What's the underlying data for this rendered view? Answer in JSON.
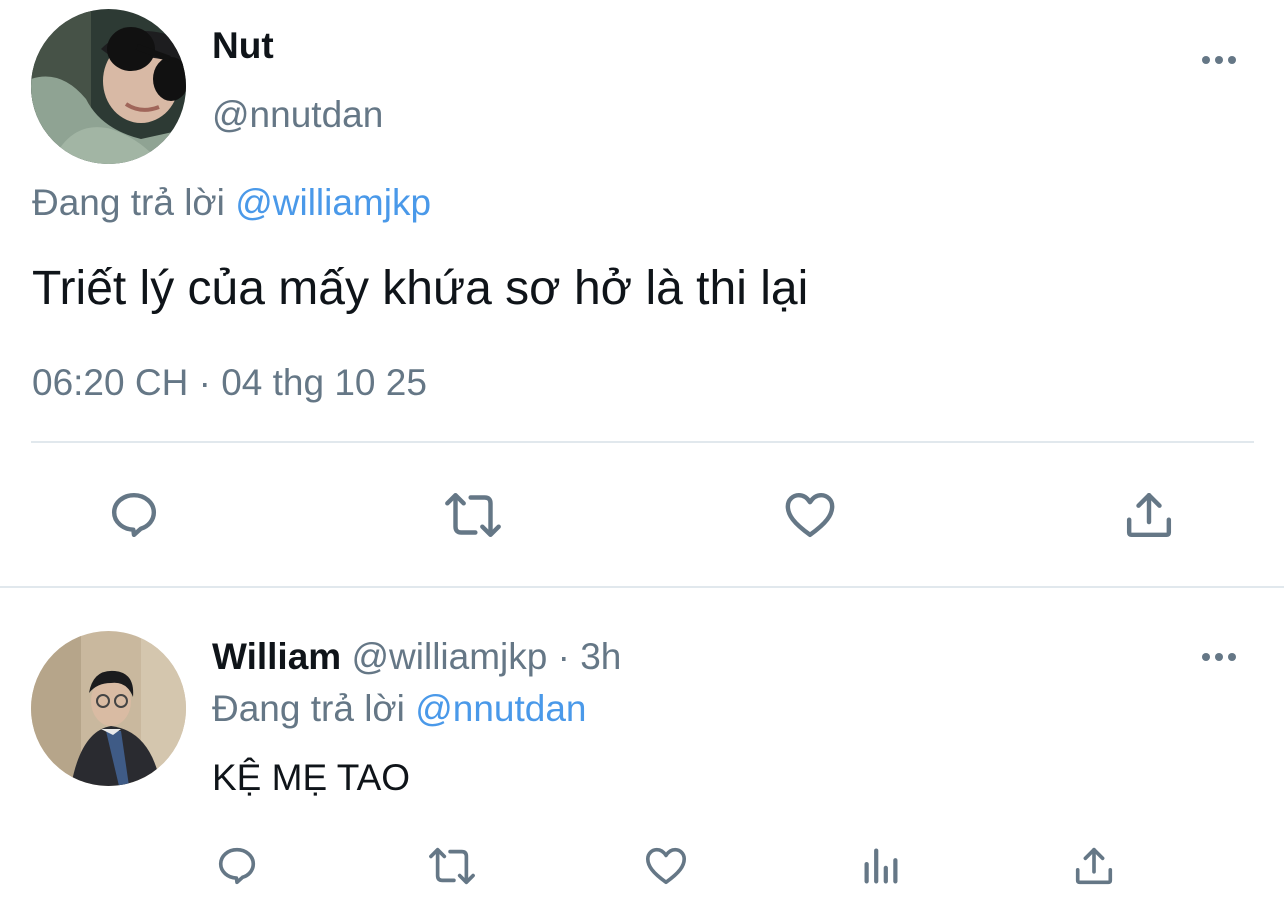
{
  "main_tweet": {
    "display_name": "Nut",
    "handle": "@nnutdan",
    "reply_prefix": "Đang trả lời",
    "reply_to": "@williamjkp",
    "text": "Triết lý của mấy khứa sơ hở là thi lại",
    "timestamp": "06:20 CH · 04 thg 10 25",
    "actions": [
      "reply-icon",
      "retweet-icon",
      "like-icon",
      "share-icon"
    ]
  },
  "reply_tweet": {
    "display_name": "William",
    "handle": "@williamjkp",
    "separator": "·",
    "time_ago": "3h",
    "reply_prefix": "Đang trả lời",
    "reply_to": "@nnutdan",
    "text": "KỆ MẸ TAO",
    "actions": [
      "reply-icon",
      "retweet-icon",
      "like-icon",
      "analytics-icon",
      "share-icon"
    ]
  },
  "colors": {
    "text": "#0f1419",
    "muted": "#657786",
    "link": "#4a99e9",
    "divider": "#e1e8ed"
  }
}
